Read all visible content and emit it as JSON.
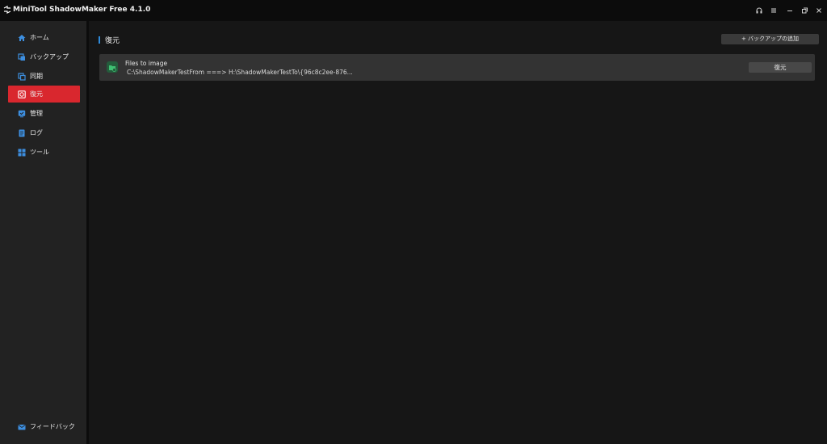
{
  "app": {
    "title": "MiniTool ShadowMaker Free 4.1.0"
  },
  "window_controls": [
    {
      "icon": "headset-icon",
      "glyph": "🎧"
    },
    {
      "icon": "menu-icon",
      "glyph": "≡"
    },
    {
      "icon": "minimize-icon",
      "glyph": "–"
    },
    {
      "icon": "restore-icon",
      "glyph": "⧉"
    },
    {
      "icon": "close-icon",
      "glyph": "✕"
    }
  ],
  "sidebar": {
    "items": [
      {
        "label": "ホーム",
        "icon": "home-icon",
        "active": false
      },
      {
        "label": "バックアップ",
        "icon": "backup-icon",
        "active": false
      },
      {
        "label": "同期",
        "icon": "sync-icon",
        "active": false
      },
      {
        "label": "復元",
        "icon": "restore-icon",
        "active": true
      },
      {
        "label": "管理",
        "icon": "manage-icon",
        "active": false
      },
      {
        "label": "ログ",
        "icon": "log-icon",
        "active": false
      },
      {
        "label": "ツール",
        "icon": "tools-icon",
        "active": false
      }
    ],
    "feedback": {
      "label": "フィードバック",
      "icon": "mail-icon"
    }
  },
  "main": {
    "title": "復元",
    "add_backup_label": "+ バックアップの追加",
    "tasks": [
      {
        "title": "Files to image",
        "path": "C:\\ShadowMakerTestFrom ===> H:\\ShadowMakerTestTo\\{96c8c2ee-876...",
        "restore_label": "復元",
        "icon": "folder-restore-icon"
      }
    ]
  },
  "colors": {
    "accent_red": "#d9272e",
    "accent_blue": "#2e8bdc",
    "sidebar_bg": "#222222",
    "main_bg": "#161616",
    "titlebar_bg": "#0c0c0c"
  }
}
